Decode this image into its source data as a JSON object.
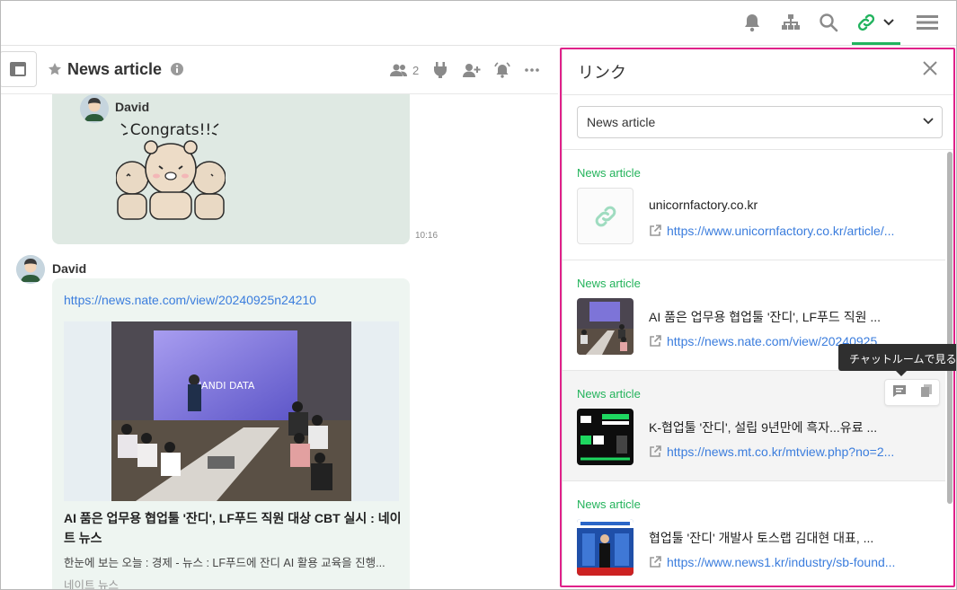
{
  "topbar": {
    "icons": [
      "bell-icon",
      "org-chart-icon",
      "search-icon",
      "link-icon",
      "chevron-down-icon",
      "menu-icon"
    ],
    "accent": "#22b35e"
  },
  "chat": {
    "room_title": "News article",
    "member_count": "2",
    "messages": [
      {
        "sender": "David",
        "sticker_text": "Congrats!!",
        "time": "10:16"
      },
      {
        "sender": "David",
        "link": "https://news.nate.com/view/20240925n24210",
        "preview_image_text": "JANDI DATA",
        "card_title": "AI 품은 업무용 협업툴 '잔디', LF푸드 직원 대상 CBT 실시 : 네이트 뉴스",
        "card_desc": "한눈에 보는 오늘 : 경제 - 뉴스 : LF푸드에 잔디 AI 활용 교육을 진행...",
        "card_source": "네이트 뉴스"
      }
    ]
  },
  "panel": {
    "title": "リンク",
    "filter_value": "News article",
    "items": [
      {
        "tag": "News article",
        "title": "unicornfactory.co.kr",
        "url": "https://www.unicornfactory.co.kr/article/..."
      },
      {
        "tag": "News article",
        "title": "AI 품은 업무용 협업툴 '잔디', LF푸드 직원 ...",
        "url": "https://news.nate.com/view/20240925..."
      },
      {
        "tag": "News article",
        "title": "K-협업툴 '잔디', 설립 9년만에 흑자...유료 ...",
        "url": "https://news.mt.co.kr/mtview.php?no=2..."
      },
      {
        "tag": "News article",
        "title": "협업툴 '잔디' 개발사 토스랩 김대현 대표, ...",
        "url": "https://www.news1.kr/industry/sb-found..."
      }
    ],
    "tooltip": "チャットルームで見る",
    "highlight_color": "#e0218a"
  }
}
